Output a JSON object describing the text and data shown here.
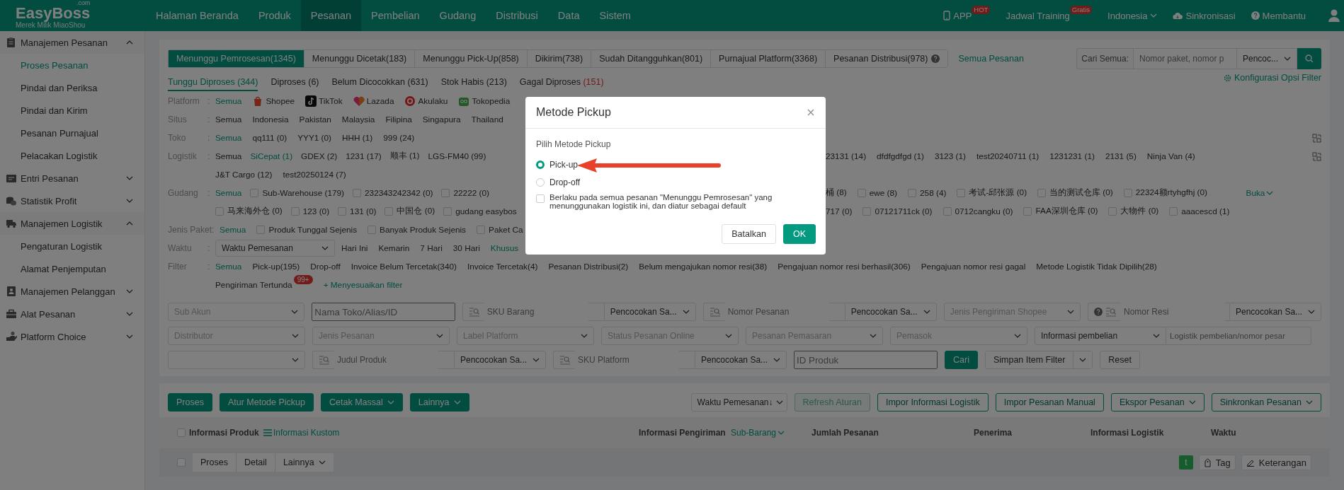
{
  "top_nav": {
    "logo": {
      "name": "EasyBoss",
      "suffix": ".com",
      "tagline": "Merek Milik MiaoShou"
    },
    "items": [
      {
        "label": "Halaman Beranda",
        "selected": false
      },
      {
        "label": "Produk",
        "selected": false
      },
      {
        "label": "Pesanan",
        "selected": true
      },
      {
        "label": "Pembelian",
        "selected": false
      },
      {
        "label": "Gudang",
        "selected": false
      },
      {
        "label": "Distribusi",
        "selected": false
      },
      {
        "label": "Data",
        "selected": false
      },
      {
        "label": "Sistem",
        "selected": false
      }
    ],
    "right": [
      {
        "kind": "app",
        "label": "APP",
        "badge": "HOT"
      },
      {
        "kind": "link",
        "label": "Jadwal Training",
        "badge": "Gratis"
      },
      {
        "kind": "dropdown",
        "label": "Indonesia"
      },
      {
        "kind": "cloud",
        "label": "Sinkronisasi"
      },
      {
        "kind": "help",
        "label": "Membantu"
      },
      {
        "kind": "user"
      }
    ]
  },
  "sidebar": [
    {
      "label": "Manajemen Pesanan",
      "expanded": true,
      "children": [
        {
          "label": "Proses Pesanan",
          "selected": true
        },
        {
          "label": "Pindai dan Periksa",
          "selected": false
        },
        {
          "label": "Pindai dan Kirim",
          "selected": false
        },
        {
          "label": "Pesanan Purnajual",
          "selected": false
        },
        {
          "label": "Pelacakan Logistik",
          "selected": false
        }
      ]
    },
    {
      "label": "Entri Pesanan",
      "expanded": false
    },
    {
      "label": "Statistik Profit",
      "expanded": false
    },
    {
      "label": "Manajemen Logistik",
      "expanded": true,
      "children": [
        {
          "label": "Pengaturan Logistik",
          "selected": false
        },
        {
          "label": "Alamat Penjemputan",
          "selected": false
        }
      ]
    },
    {
      "label": "Manajemen Pelanggan",
      "expanded": false
    },
    {
      "label": "Alat Pesanan",
      "expanded": false
    },
    {
      "label": "Platform Choice",
      "expanded": false
    }
  ],
  "status_tabs": [
    {
      "label": "Menunggu Pemrosesan(1345)",
      "selected": true,
      "help": false
    },
    {
      "label": "Menunggu Dicetak(183)",
      "selected": false,
      "help": false
    },
    {
      "label": "Menunggu Pick-Up(858)",
      "selected": false,
      "help": false
    },
    {
      "label": "Dikirim(738)",
      "selected": false,
      "help": false
    },
    {
      "label": "Sudah Ditangguhkan(801)",
      "selected": false,
      "help": false
    },
    {
      "label": "Purnajual Platform(3368)",
      "selected": false,
      "help": false
    },
    {
      "label": "Pesanan Distribusi(978)",
      "selected": false,
      "help": true
    }
  ],
  "all_orders_link": "Semua Pesanan",
  "search": {
    "label": "Cari Semua:",
    "placeholder": "Nomor paket, nomor p",
    "match": "Pencoc..."
  },
  "filter_config": "Konfigurasi Opsi Filter",
  "sub_tabs": [
    {
      "label": "Tunggu Diproses",
      "count": "(344)",
      "selected": true,
      "kind": "normal"
    },
    {
      "label": "Diproses",
      "count": "(6)",
      "selected": false,
      "kind": "normal"
    },
    {
      "label": "Belum Dicocokkan",
      "count": "(631)",
      "selected": false,
      "kind": "normal"
    },
    {
      "label": "Stok Habis",
      "count": "(213)",
      "selected": false,
      "kind": "normal"
    },
    {
      "label": "Gagal Diproses",
      "count": "(151)",
      "selected": false,
      "kind": "error"
    }
  ],
  "filters": [
    {
      "label": "Platform",
      "separator": ":",
      "expandable": false,
      "lines": [
        {
          "before": [
            {
              "kind": "link",
              "label": "Semua",
              "selected": true
            },
            {
              "kind": "platform",
              "label": "Shopee"
            },
            {
              "kind": "platform",
              "label": "TikTok"
            },
            {
              "kind": "platform",
              "label": "Lazada"
            },
            {
              "kind": "platform",
              "label": "Akulaku"
            },
            {
              "kind": "platform",
              "label": "Tokopedia"
            }
          ]
        }
      ]
    },
    {
      "label": "Situs",
      "separator": ":",
      "expandable": false,
      "lines": [
        {
          "before": [
            {
              "kind": "link",
              "label": "Semua",
              "selected": false
            },
            {
              "kind": "link",
              "label": "Indonesia",
              "selected": false
            },
            {
              "kind": "link",
              "label": "Pakistan",
              "selected": false
            },
            {
              "kind": "link",
              "label": "Malaysia",
              "selected": false
            },
            {
              "kind": "link",
              "label": "Filipina",
              "selected": false
            },
            {
              "kind": "link",
              "label": "Singapura",
              "selected": false
            },
            {
              "kind": "link",
              "label": "Thailand",
              "selected": false
            }
          ]
        }
      ]
    },
    {
      "label": "Toko",
      "separator": ":",
      "expandable": true,
      "lines": [
        {
          "before": [
            {
              "kind": "link",
              "label": "Semua",
              "selected": true
            },
            {
              "kind": "link",
              "label": "qq111 (0)",
              "selected": false
            },
            {
              "kind": "link",
              "label": "YYY1 (0)",
              "selected": false
            },
            {
              "kind": "link",
              "label": "HHH (1)",
              "selected": false
            },
            {
              "kind": "link",
              "label": "999 (24)",
              "selected": false
            }
          ]
        }
      ]
    },
    {
      "label": "Logistik",
      "separator": ":",
      "expandable": true,
      "lines": [
        {
          "before": [
            {
              "kind": "link",
              "label": "Semua",
              "selected": false
            },
            {
              "kind": "link",
              "label": "SiCepat (1)",
              "selected": true
            },
            {
              "kind": "link",
              "label": "GDEX (2)",
              "selected": false
            },
            {
              "kind": "link",
              "label": "1231 (17)",
              "selected": false
            },
            {
              "kind": "link",
              "label": "顺丰 (1)",
              "selected": false
            },
            {
              "kind": "link",
              "label": "LGS-FM40 (99)",
              "selected": false
            }
          ],
          "after": [
            {
              "kind": "link",
              "label": "23131 (14)",
              "selected": false
            },
            {
              "kind": "link",
              "label": "dfdfgdfgd (1)",
              "selected": false
            },
            {
              "kind": "link",
              "label": "3123 (1)",
              "selected": false
            },
            {
              "kind": "link",
              "label": "test20240711 (1)",
              "selected": false
            },
            {
              "kind": "link",
              "label": "1231231 (1)",
              "selected": false
            },
            {
              "kind": "link",
              "label": "2131 (5)",
              "selected": false
            },
            {
              "kind": "link",
              "label": "Ninja Van (4)",
              "selected": false
            }
          ]
        },
        {
          "before": [
            {
              "kind": "link",
              "label": "J&T Cargo (12)",
              "selected": false
            },
            {
              "kind": "link",
              "label": "test20250124 (7)",
              "selected": false
            }
          ]
        }
      ]
    },
    {
      "label": "Gudang",
      "separator": ":",
      "expandable": false,
      "more": "Buka",
      "lines": [
        {
          "before": [
            {
              "kind": "link",
              "label": "Semua",
              "selected": true
            },
            {
              "kind": "checkbox",
              "label": "Sub-Warehouse (179)",
              "checked": false
            },
            {
              "kind": "checkbox",
              "label": "232343242342 (0)",
              "checked": false
            },
            {
              "kind": "checkbox",
              "label": "22222 (0)",
              "checked": false
            }
          ],
          "after": [
            {
              "kind": "fragment",
              "label": "桶 (8)"
            },
            {
              "kind": "checkbox",
              "label": "ewe (8)",
              "checked": false
            },
            {
              "kind": "checkbox",
              "label": "258 (4)",
              "checked": false
            },
            {
              "kind": "checkbox",
              "label": "考试-邱张源 (0)",
              "checked": false
            },
            {
              "kind": "checkbox",
              "label": "当的测试仓库 (0)",
              "checked": false
            },
            {
              "kind": "checkbox",
              "label": "22324额rtyhgfhj (0)",
              "checked": false
            }
          ]
        },
        {
          "before": [
            {
              "kind": "checkbox",
              "label": "马来海外仓 (0)",
              "checked": false
            },
            {
              "kind": "checkbox",
              "label": "123 (0)",
              "checked": false
            },
            {
              "kind": "checkbox",
              "label": "131 (0)",
              "checked": false
            },
            {
              "kind": "checkbox",
              "label": "中国仓 (0)",
              "checked": false
            },
            {
              "kind": "checkbox",
              "label": "gudang easybos",
              "checked": false
            }
          ],
          "after": [
            {
              "kind": "fragment",
              "label": "717 (0)"
            },
            {
              "kind": "checkbox",
              "label": "07121711ck (0)",
              "checked": false
            },
            {
              "kind": "checkbox",
              "label": "0712cangku (0)",
              "checked": false
            },
            {
              "kind": "checkbox",
              "label": "FAA深圳仓库 (0)",
              "checked": false
            },
            {
              "kind": "checkbox",
              "label": "大物件 (0)",
              "checked": false
            },
            {
              "kind": "checkbox",
              "label": "aaacescd (1)",
              "checked": false
            }
          ]
        }
      ]
    },
    {
      "label": "Jenis Paket",
      "separator": ":",
      "expandable": false,
      "lines": [
        {
          "before": [
            {
              "kind": "link",
              "label": "Semua",
              "selected": true
            },
            {
              "kind": "checkbox",
              "label": "Produk Tunggal Sejenis",
              "checked": false
            },
            {
              "kind": "checkbox",
              "label": "Banyak Produk Sejenis",
              "checked": false
            },
            {
              "kind": "checkbox",
              "label": "Paket Ca",
              "checked": false
            }
          ]
        }
      ]
    },
    {
      "label": "Waktu",
      "separator": ":",
      "expandable": false,
      "select": "Waktu Pemesanan",
      "lines": [
        {
          "before": [
            {
              "kind": "link",
              "label": "Hari Ini",
              "selected": false
            },
            {
              "kind": "link",
              "label": "Kemarin",
              "selected": false
            },
            {
              "kind": "link",
              "label": "7 Hari",
              "selected": false
            },
            {
              "kind": "link",
              "label": "30 Hari",
              "selected": false
            },
            {
              "kind": "link",
              "label": "Khusus",
              "selected": true
            }
          ]
        }
      ]
    },
    {
      "label": "Filter",
      "separator": ":",
      "expandable": false,
      "lines": [
        {
          "before": [
            {
              "kind": "link",
              "label": "Semua",
              "selected": true
            },
            {
              "kind": "link",
              "label": "Pick-up(195)",
              "selected": false
            },
            {
              "kind": "link",
              "label": "Drop-off",
              "selected": false
            },
            {
              "kind": "link",
              "label": "Invoice Belum Tercetak(340)",
              "selected": false
            },
            {
              "kind": "link",
              "label": "Invoice Tercetak(4)",
              "selected": false
            },
            {
              "kind": "link",
              "label": "Pesanan Distribusi(2)",
              "selected": false
            },
            {
              "kind": "link",
              "label": "Belum mengajukan nomor resi(38)",
              "selected": false
            },
            {
              "kind": "link",
              "label": "Pengajuan nomor resi berhasil(306)",
              "selected": false
            },
            {
              "kind": "link",
              "label": "Pengajuan nomor resi gagal",
              "selected": false
            },
            {
              "kind": "link",
              "label": "Metode Logistik Tidak Dipilih(28)",
              "selected": false
            }
          ]
        },
        {
          "before": [
            {
              "kind": "link",
              "label": "Pengiriman Tertunda",
              "selected": false,
              "badge": "99+"
            },
            {
              "kind": "add",
              "label": "+ Menyesuaikan filter"
            }
          ]
        }
      ]
    }
  ],
  "search_rows": [
    [
      {
        "kind": "select",
        "placeholder": "Sub Akun"
      },
      {
        "kind": "input",
        "placeholder": "Nama Toko/Alias/ID"
      },
      {
        "kind": "match",
        "placeholder": "SKU Barang",
        "match": "Pencocokan Sa...",
        "help": false
      },
      {
        "kind": "match",
        "placeholder": "Nomor Pesanan",
        "match": "Pencocokan Sa...",
        "help": false
      },
      {
        "kind": "select",
        "placeholder": "Jenis Pengiriman Shopee"
      },
      {
        "kind": "match",
        "placeholder": "Nomor Resi",
        "match": "Pencocokan Sa...",
        "help": true
      }
    ],
    [
      {
        "kind": "select",
        "placeholder": "Distributor"
      },
      {
        "kind": "select",
        "placeholder": "Jenis Pesanan"
      },
      {
        "kind": "select",
        "placeholder": "Label Platform"
      },
      {
        "kind": "select",
        "placeholder": "Status Pesanan Online"
      },
      {
        "kind": "select",
        "placeholder": "Pesanan Pemasaran"
      },
      {
        "kind": "select",
        "placeholder": "Pemasok"
      },
      {
        "kind": "select_input",
        "value": "Informasi pembelian",
        "placeholder": "Logistik pembelian/nomor pesar"
      }
    ],
    [
      {
        "kind": "select"
      },
      {
        "kind": "match",
        "placeholder": "Judul Produk",
        "match": "Pencocokan Sa...",
        "help": false
      },
      {
        "kind": "match",
        "placeholder": "SKU Platform",
        "match": "Pencocokan Sa...",
        "help": false
      },
      {
        "kind": "input",
        "placeholder": "ID Produk"
      },
      {
        "kind": "primary",
        "label": "Cari"
      },
      {
        "kind": "split",
        "label": "Simpan Item Filter"
      },
      {
        "kind": "button",
        "label": "Reset"
      }
    ]
  ],
  "actions": {
    "left": [
      {
        "label": "Proses",
        "dropdown": false
      },
      {
        "label": "Atur Metode Pickup",
        "dropdown": false
      },
      {
        "label": "Cetak Massal",
        "dropdown": true
      },
      {
        "label": "Lainnya",
        "dropdown": true
      }
    ],
    "sort": "Waktu Pemesanan↓",
    "right": [
      {
        "label": "Refresh Aturan",
        "disabled": true,
        "dropdown": false
      },
      {
        "label": "Impor Informasi Logistik",
        "disabled": false,
        "dropdown": false
      },
      {
        "label": "Impor Pesanan Manual",
        "disabled": false,
        "dropdown": false
      },
      {
        "label": "Ekspor Pesanan",
        "disabled": false,
        "dropdown": true
      },
      {
        "label": "Sinkronkan Pesanan",
        "disabled": false,
        "dropdown": true
      }
    ]
  },
  "table": {
    "select_all": {
      "checked": false
    },
    "columns": [
      {
        "label": "Informasi Produk",
        "kind": "text"
      },
      {
        "label": "Informasi Kustom",
        "kind": "link"
      },
      {
        "label": "Informasi Pengiriman",
        "kind": "text"
      },
      {
        "label": "Sub-Barang",
        "kind": "dropdown"
      },
      {
        "label": "Jumlah Pesanan",
        "kind": "text"
      },
      {
        "label": "Penerima",
        "kind": "text"
      },
      {
        "label": "Informasi Logistik",
        "kind": "text"
      },
      {
        "label": "Waktu",
        "kind": "text"
      }
    ],
    "group": {
      "checked": false,
      "actions": [
        {
          "label": "Proses",
          "dropdown": false
        },
        {
          "label": "Detail",
          "dropdown": false
        },
        {
          "label": "Lainnya",
          "dropdown": true
        }
      ],
      "tag_letter": "t",
      "buttons": [
        {
          "kind": "tag",
          "label": "Tag"
        },
        {
          "kind": "note",
          "label": "Keterangan"
        }
      ]
    }
  },
  "dialog": {
    "title": "Metode Pickup",
    "prompt": "Pilih Metode Pickup",
    "options": [
      {
        "label": "Pick-up",
        "selected": true
      },
      {
        "label": "Drop-off",
        "selected": false
      }
    ],
    "apply_all": {
      "label": "Berlaku pada semua pesanan \"Menunggu Pemrosesan\" yang menunggunakan logistik ini, dan diatur sebagai default",
      "checked": false
    },
    "buttons": [
      {
        "kind": "cancel",
        "label": "Batalkan"
      },
      {
        "kind": "ok",
        "label": "OK"
      }
    ]
  }
}
